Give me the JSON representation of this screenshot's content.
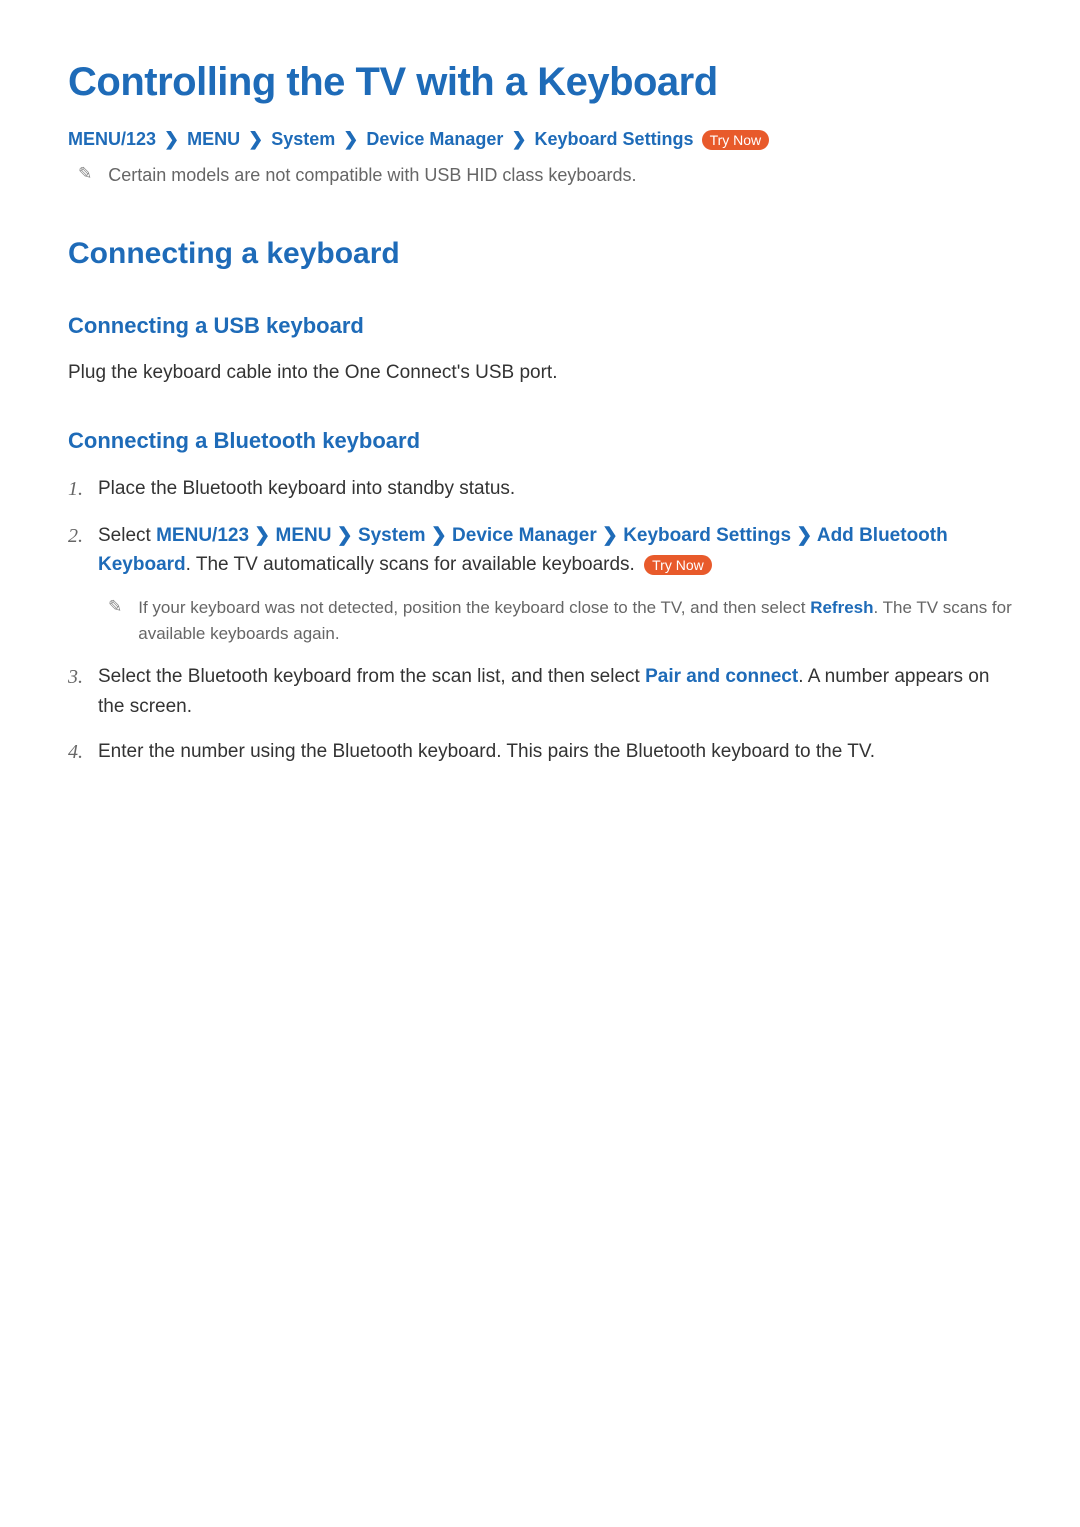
{
  "title": "Controlling the TV with a Keyboard",
  "breadcrumb1": {
    "items": [
      "MENU/123",
      "MENU",
      "System",
      "Device Manager",
      "Keyboard Settings"
    ],
    "tryNowLabel": "Try Now"
  },
  "note1": "Certain models are not compatible with USB HID class keyboards.",
  "section1": {
    "heading": "Connecting a keyboard",
    "sub1": {
      "heading": "Connecting a USB keyboard",
      "body": "Plug the keyboard cable into the One Connect's USB port."
    },
    "sub2": {
      "heading": "Connecting a Bluetooth keyboard",
      "steps": {
        "s1": {
          "num": "1.",
          "text": "Place the Bluetooth keyboard into standby status."
        },
        "s2": {
          "num": "2.",
          "prefix": "Select ",
          "bc": [
            "MENU/123",
            "MENU",
            "System",
            "Device Manager",
            "Keyboard Settings",
            "Add Bluetooth Keyboard"
          ],
          "suffix": ". The TV automatically scans for available keyboards. ",
          "tryNowLabel": "Try Now",
          "notePrefix": "If your keyboard was not detected, position the keyboard close to the TV, and then select ",
          "noteHighlight": "Refresh",
          "noteSuffix": ". The TV scans for available keyboards again."
        },
        "s3": {
          "num": "3.",
          "prefix": "Select the Bluetooth keyboard from the scan list, and then select ",
          "highlight": "Pair and connect",
          "suffix": ". A number appears on the screen."
        },
        "s4": {
          "num": "4.",
          "text": "Enter the number using the Bluetooth keyboard. This pairs the Bluetooth keyboard to the TV."
        }
      }
    }
  }
}
